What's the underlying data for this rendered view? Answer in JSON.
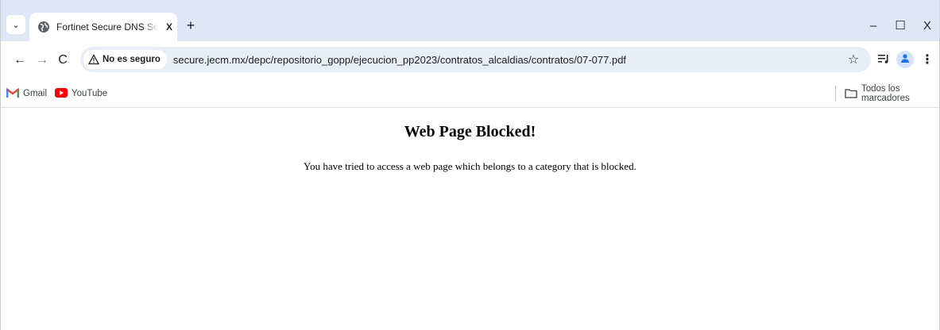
{
  "tab": {
    "title": "Fortinet Secure DNS Service Portal",
    "close_label": "X"
  },
  "window_controls": {
    "minimize": "–",
    "maximize": "☐",
    "close": "X"
  },
  "toolbar": {
    "security_label": "No es seguro",
    "url": "secure.jecm.mx/depc/repositorio_gopp/ejecucion_pp2023/contratos_alcaldias/contratos/07-077.pdf"
  },
  "bookmarks": {
    "items": [
      {
        "label": "Gmail",
        "icon": "gmail-icon"
      },
      {
        "label": "YouTube",
        "icon": "youtube-icon"
      }
    ],
    "all_bookmarks_label": "Todos los marcadores"
  },
  "page": {
    "heading": "Web Page Blocked!",
    "message": "You have tried to access a web page which belongs to a category that is blocked."
  },
  "colors": {
    "tabstrip_bg": "#dfe7f7",
    "omnibox_bg": "#e9eef6",
    "gmail_red": "#ea4335",
    "youtube_red": "#ff0000"
  }
}
